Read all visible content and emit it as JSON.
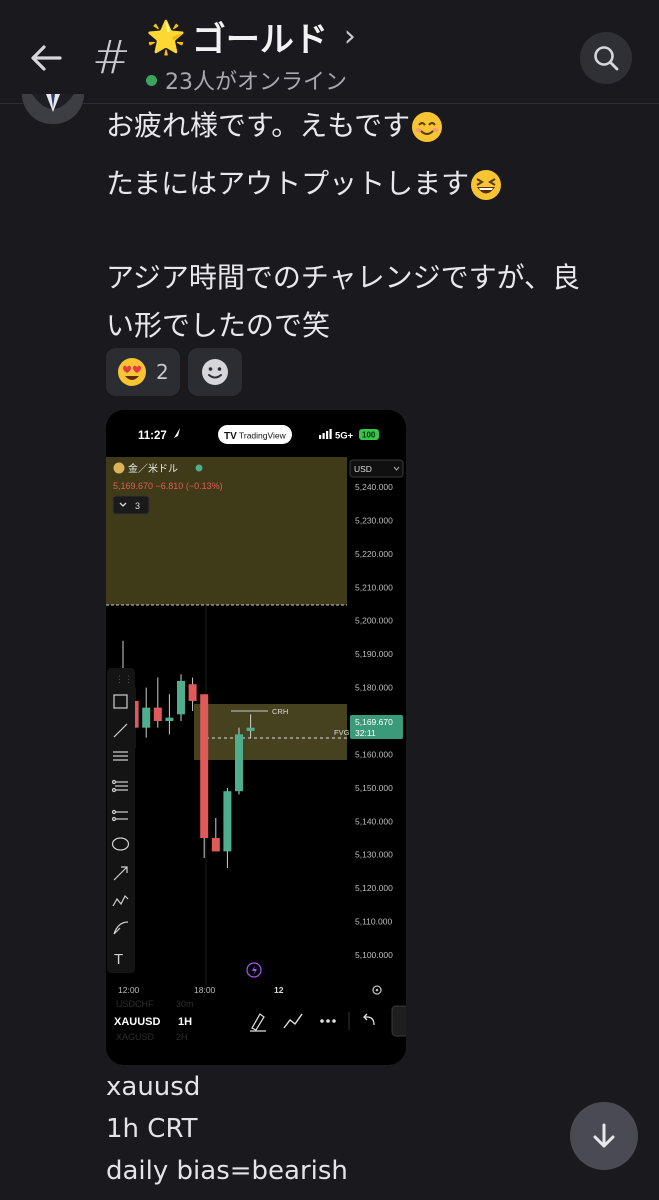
{
  "header": {
    "channel_hash": "#",
    "channel_emoji": "🌟",
    "channel_name": "ゴールド",
    "chevron": "›",
    "online_text": "23人がオンライン",
    "online_color": "#3ba55d"
  },
  "message": {
    "lines": [
      "お疲れ様です。えもです",
      "たまにはアウトプットします",
      "アジア時間でのチャレンジですが、良",
      "い形でしたので笑"
    ],
    "reaction_emoji": "heart-eyes-emoji",
    "reaction_count": "2",
    "caption": [
      "xauusd",
      "1h CRT",
      "daily bias=bearish"
    ]
  },
  "phone": {
    "time": "11:27",
    "app_badge": "TradingView",
    "network": "5G+",
    "battery": "100",
    "symbol_name": "金／米ドル",
    "quote": "5,169.670 −6.810 (−0.13%)",
    "indicator_count": "3",
    "currency": "USD",
    "price_tag": "5,169.670",
    "countdown": "32:11",
    "crh_label": "CRH",
    "fvg_label": "FVG",
    "ticker": "XAUUSD",
    "ticker_ghost_above": "USDCHF",
    "ticker_ghost_below": "XAGUSD",
    "interval": "1H",
    "interval_ghost_above": "30m",
    "interval_ghost_below": "2H"
  },
  "chart_data": {
    "type": "candlestick",
    "y_ticks": [
      5240,
      5230,
      5220,
      5210,
      5200,
      5190,
      5180,
      5170,
      5160,
      5150,
      5140,
      5130,
      5120,
      5110,
      5100
    ],
    "y_tick_labels": [
      "5,240.000",
      "5,230.000",
      "5,220.000",
      "5,210.000",
      "5,200.000",
      "5,190.000",
      "5,180.000",
      "5,170.000",
      "5,160.000",
      "5,150.000",
      "5,140.000",
      "5,130.000",
      "5,120.000",
      "5,110.000",
      "5,100.000"
    ],
    "x_tick_labels": [
      "12:00",
      "18:00",
      "12"
    ],
    "ylim": [
      5095,
      5245
    ],
    "current_price": 5169.67,
    "candles": [
      {
        "o": 5183,
        "h": 5194,
        "l": 5173,
        "c": 5177
      },
      {
        "o": 5176,
        "h": 5180,
        "l": 5162,
        "c": 5168
      },
      {
        "o": 5168,
        "h": 5180,
        "l": 5165,
        "c": 5174
      },
      {
        "o": 5174,
        "h": 5183,
        "l": 5168,
        "c": 5170
      },
      {
        "o": 5170,
        "h": 5178,
        "l": 5166,
        "c": 5171
      },
      {
        "o": 5172,
        "h": 5184,
        "l": 5170,
        "c": 5182
      },
      {
        "o": 5181,
        "h": 5183,
        "l": 5173,
        "c": 5176
      },
      {
        "o": 5178,
        "h": 5178,
        "l": 5129,
        "c": 5135
      },
      {
        "o": 5135,
        "h": 5141,
        "l": 5131,
        "c": 5131
      },
      {
        "o": 5131,
        "h": 5150,
        "l": 5126,
        "c": 5149
      },
      {
        "o": 5149,
        "h": 5168,
        "l": 5148,
        "c": 5166
      },
      {
        "o": 5167,
        "h": 5172,
        "l": 5165,
        "c": 5168
      }
    ],
    "colors": {
      "up": "#4fae8e",
      "down": "#e05a5a",
      "zone": "#4a4520",
      "price_tag": "#3a9a7a"
    }
  }
}
